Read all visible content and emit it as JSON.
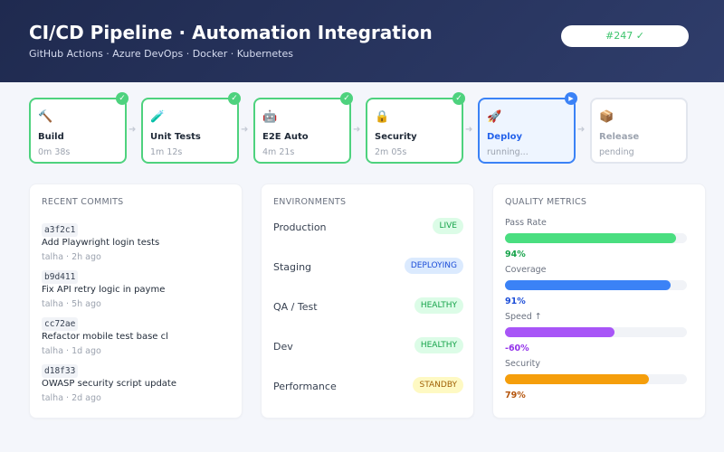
{
  "header": {
    "title": "CI/CD Pipeline · Automation Integration",
    "subtitle": "GitHub Actions · Azure DevOps · Docker · Kubernetes",
    "run_badge": "#247 ✓"
  },
  "stages": [
    {
      "icon": "hammer-icon",
      "glyph": "🔨",
      "name": "Build",
      "time": "0m 38s",
      "status": "success",
      "marker": "✓"
    },
    {
      "icon": "test-tube-icon",
      "glyph": "🧪",
      "name": "Unit Tests",
      "time": "1m 12s",
      "status": "success",
      "marker": "✓"
    },
    {
      "icon": "robot-icon",
      "glyph": "🤖",
      "name": "E2E Auto",
      "time": "4m 21s",
      "status": "success",
      "marker": "✓"
    },
    {
      "icon": "lock-icon",
      "glyph": "🔒",
      "name": "Security",
      "time": "2m 05s",
      "status": "success",
      "marker": "✓"
    },
    {
      "icon": "rocket-icon",
      "glyph": "🚀",
      "name": "Deploy",
      "time": "running...",
      "status": "running",
      "marker": "▶"
    },
    {
      "icon": "package-icon",
      "glyph": "📦",
      "name": "Release",
      "time": "pending",
      "status": "pending",
      "marker": ""
    }
  ],
  "arrow_glyph": "➜",
  "commits": {
    "title": "RECENT COMMITS",
    "items": [
      {
        "hash": "a3f2c1",
        "message": "Add Playwright login tests",
        "meta": "talha · 2h ago"
      },
      {
        "hash": "b9d411",
        "message": "Fix API retry logic in payme",
        "meta": "talha · 5h ago"
      },
      {
        "hash": "cc72ae",
        "message": "Refactor mobile test base cl",
        "meta": "talha · 1d ago"
      },
      {
        "hash": "d18f33",
        "message": "OWASP security script update",
        "meta": "talha · 2d ago"
      }
    ]
  },
  "environments": {
    "title": "ENVIRONMENTS",
    "items": [
      {
        "name": "Production",
        "status": "LIVE",
        "kind": "live"
      },
      {
        "name": "Staging",
        "status": "DEPLOYING",
        "kind": "deploying"
      },
      {
        "name": "QA / Test",
        "status": "HEALTHY",
        "kind": "healthy"
      },
      {
        "name": "Dev",
        "status": "HEALTHY",
        "kind": "healthy"
      },
      {
        "name": "Performance",
        "status": "STANDBY",
        "kind": "standby"
      }
    ]
  },
  "metrics": {
    "title": "QUALITY METRICS",
    "items": [
      {
        "label": "Pass Rate",
        "value": "94%",
        "fill": 0.94,
        "color": "#4ade80",
        "text_color": "#16a34a"
      },
      {
        "label": "Coverage",
        "value": "91%",
        "fill": 0.91,
        "color": "#3b82f6",
        "text_color": "#1d4ed8"
      },
      {
        "label": "Speed ↑",
        "value": "-60%",
        "fill": 0.6,
        "color": "#a855f7",
        "text_color": "#9333ea"
      },
      {
        "label": "Security",
        "value": "79%",
        "fill": 0.79,
        "color": "#f59e0b",
        "text_color": "#b45309"
      }
    ]
  }
}
